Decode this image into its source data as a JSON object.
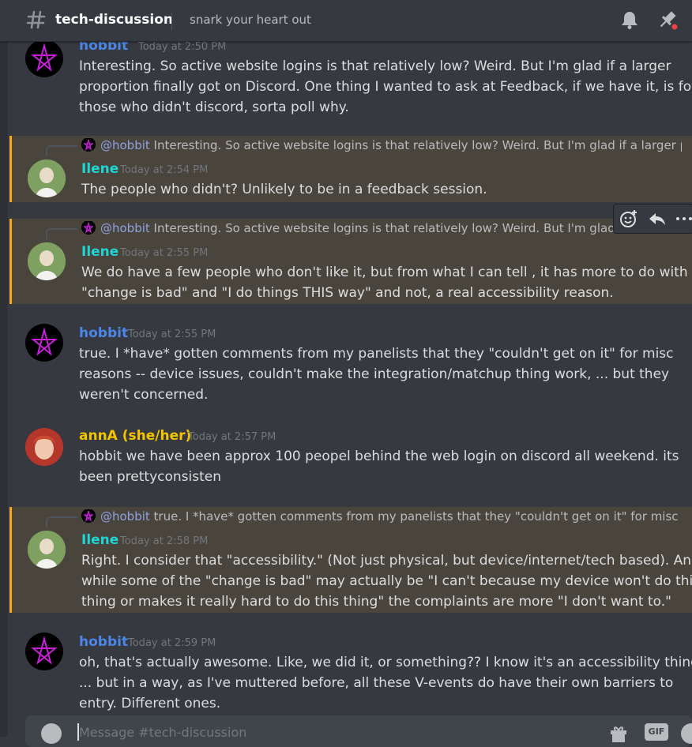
{
  "channel": {
    "name": "tech-discussion",
    "topic": "snark your heart out"
  },
  "icons": {
    "header": [
      "hashtag-icon",
      "bell-icon",
      "pin-icon"
    ],
    "hover_actions": [
      "add-reaction-icon",
      "reply-icon",
      "more-icon"
    ]
  },
  "colors": {
    "hobbit": "#4b86e8",
    "ilene": "#1fd5d5",
    "anna": "#f5c400",
    "mention": "#8ea1e1",
    "highlight_bar": "#faa81a"
  },
  "messages": [
    {
      "author": "hobbit",
      "timestamp": "Today at 2:50 PM",
      "lines": [
        "Interesting.  So active website logins is that relatively low?  Weird.  But I'm glad if a larger",
        "proportion finally got on Discord.  One thing I wanted to ask at Feedback, if we have it, is for",
        "those who didn't discord, sorta poll why."
      ]
    },
    {
      "author": "Ilene",
      "timestamp": "Today at 2:54 PM",
      "reply_mention": "@hobbit",
      "reply_text": " Interesting.  So active website logins is that relatively low?  Weird.  But I'm glad if a larger pr...",
      "lines": [
        "The people who didn't? Unlikely to be in a feedback session."
      ]
    },
    {
      "author": "Ilene",
      "timestamp": "Today at 2:55 PM",
      "reply_mention": "@hobbit",
      "reply_text": " Interesting.  So active website logins is that relatively low?  Weird.  But I'm glad if a l",
      "lines": [
        "We do have a few people who don't like it, but from what I can tell , it has more to do with",
        "\"change is bad\" and \"I do things THIS way\" and not, a real accessibility reason."
      ]
    },
    {
      "author": "hobbit",
      "timestamp": "Today at 2:55 PM",
      "lines": [
        "true.   I *have* gotten comments from my panelists that they \"couldn't get on it\" for misc",
        "reasons -- device issues, couldn't make the integration/matchup thing work, ... but they",
        "weren't concerned."
      ]
    },
    {
      "author": "annA (she/her)",
      "timestamp": "Today at 2:57 PM",
      "lines": [
        "hobbit we have been approx 100 peopel behind the web login on discord all weekend.  its",
        "been prettyconsisten"
      ]
    },
    {
      "author": "Ilene",
      "timestamp": "Today at 2:58 PM",
      "reply_mention": "@hobbit",
      "reply_text": " true.   I *have* gotten comments from my panelists that they \"couldn't get on it\" for misc rea...",
      "lines": [
        "Right. I consider that \"accessibility.\" (Not just physical, but device/internet/tech based). And",
        "while some of the \"change is bad\" may actually be \"I can't because my device won't do this",
        "thing or makes it really hard to do this thing\" the complaints are more \"I don't want to.\""
      ]
    },
    {
      "author": "hobbit",
      "timestamp": "Today at 2:59 PM",
      "lines": [
        "oh, that's actually awesome.  Like, we did it, or something??  I know it's an accessibility thing",
        "... but in a way, as I've muttered before, all these V-events do have their own barriers to",
        "entry.  Different ones."
      ]
    }
  ],
  "composer": {
    "placeholder": "Message #tech-discussion",
    "gif_label": "GIF"
  }
}
